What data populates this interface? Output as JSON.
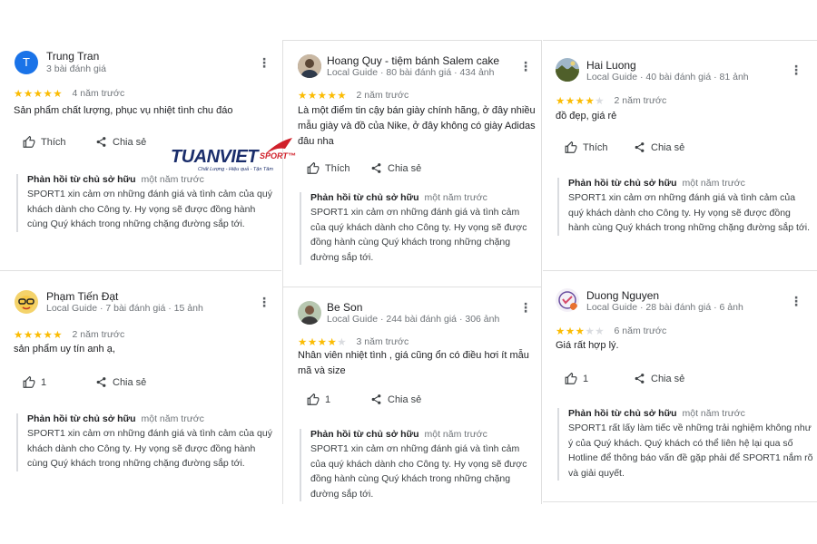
{
  "labels": {
    "like": "Thích",
    "share": "Chia sẻ",
    "owner_reply": "Phản hồi từ chủ sở hữu"
  },
  "logo": {
    "brand": "TUANVIET",
    "suffix": "SPORT™",
    "tagline": "Chất Lượng - Hiệu quả - Tận Tâm",
    "colors": {
      "navy": "#1a2d6b",
      "red": "#d0202a"
    }
  },
  "reviews": [
    {
      "name": "Trung Tran",
      "meta": "3 bài đánh giá",
      "avatar_letter": "T",
      "avatar_color": "#1a73e8",
      "stars": 5,
      "when": "4 năm trước",
      "text": "Sản phẩm chất lượng, phục vụ nhiệt tình chu đáo",
      "like_label": "Thích",
      "reply_when": "một năm trước",
      "reply": "SPORT1 xin cảm ơn những đánh giá và tình cảm của quý khách dành cho Công ty. Hy vọng sẽ được đồng hành cùng Quý khách trong những chặng đường sắp tới."
    },
    {
      "name": "Hoang Quy - tiệm bánh Salem cake",
      "meta": "Local Guide · 80 bài đánh giá · 434 ảnh",
      "avatar_icon": "user-photo-icon",
      "stars": 5,
      "when": "2 năm trước",
      "text": "Là một điểm tin cậy bán giày chính hãng, ở đây nhiều mẫu giày và đồ của Nike, ở đây không có giày Adidas đâu nha",
      "like_label": "Thích",
      "reply_when": "một năm trước",
      "reply": "SPORT1 xin cảm ơn những đánh giá và tình cảm của quý khách dành cho Công ty. Hy vọng sẽ được đồng hành cùng Quý khách trong những chặng đường sắp tới."
    },
    {
      "name": "Hai Luong",
      "meta": "Local Guide · 40 bài đánh giá · 81 ảnh",
      "avatar_icon": "landscape-photo-icon",
      "stars": 4,
      "when": "2 năm trước",
      "text": "đồ đẹp, giá rẻ",
      "like_label": "Thích",
      "reply_when": "một năm trước",
      "reply": "SPORT1 xin cảm ơn những đánh giá và tình cảm của quý khách dành cho Công ty. Hy vọng sẽ được đồng hành cùng Quý khách trong những chặng đường sắp tới."
    },
    {
      "name": "Phạm Tiến Đạt",
      "meta": "Local Guide · 7 bài đánh giá · 15 ảnh",
      "avatar_icon": "cartoon-avatar-icon",
      "stars": 5,
      "when": "2 năm trước",
      "text": "sản phẩm uy tín anh ạ,",
      "like_label": "1",
      "reply_when": "một năm trước",
      "reply": "SPORT1 xin cảm ơn những đánh giá và tình cảm của quý khách dành cho Công ty. Hy vọng sẽ được đồng hành cùng Quý khách trong những chặng đường sắp tới."
    },
    {
      "name": "Be Son",
      "meta": "Local Guide · 244 bài đánh giá · 306 ảnh",
      "avatar_icon": "user-photo-icon",
      "stars": 4,
      "when": "3 năm trước",
      "text": "Nhân viên nhiệt tình , giá cũng ổn có điều hơi ít mẫu mã và size",
      "like_label": "1",
      "reply_when": "một năm trước",
      "reply": "SPORT1 xin cảm ơn những đánh giá và tình cảm của quý khách dành cho Công ty. Hy vọng sẽ được đồng hành cùng Quý khách trong những chặng đường sắp tới."
    },
    {
      "name": "Duong Nguyen",
      "meta": "Local Guide · 28 bài đánh giá · 6 ảnh",
      "avatar_icon": "drawing-avatar-icon",
      "stars": 3,
      "when": "6 năm trước",
      "text": "Giá rất hợp lý.",
      "like_label": "1",
      "reply_when": "một năm trước",
      "reply": "SPORT1 rất lấy làm tiếc về những trải nghiệm không như ý của Quý khách. Quý khách có thể liên hệ lại qua số Hotline để thông báo vấn đề gặp phải để SPORT1 nắm rõ và giải quyết."
    }
  ]
}
